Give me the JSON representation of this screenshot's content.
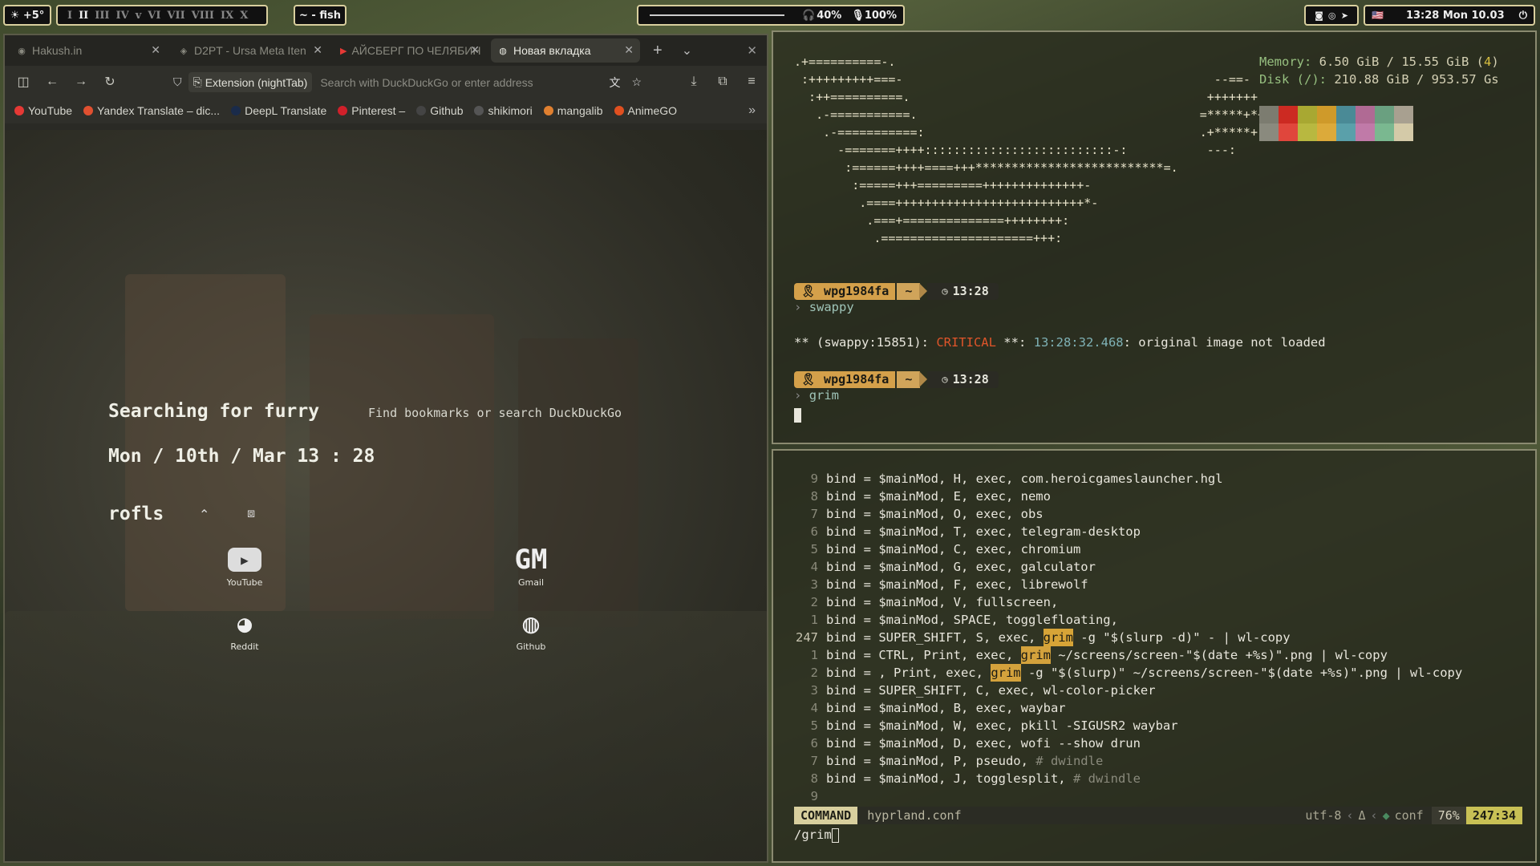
{
  "topbar": {
    "weather": "☀ +5°",
    "workspaces": [
      "I",
      "II",
      "III",
      "IV",
      "v",
      "VI",
      "VII",
      "VIII",
      "IX",
      "X"
    ],
    "active_workspace_index": 1,
    "active_window": "~ - fish",
    "volume": "40%",
    "mic": "100%",
    "clock": "13:28 Mon 10.03",
    "tray_icons": [
      "discord-icon",
      "steam-icon",
      "telegram-icon"
    ],
    "flag": "🇺🇸",
    "power_icon": "⏻"
  },
  "browser": {
    "tabs": [
      {
        "label": "Hakush.in",
        "icon": "◉",
        "active": false
      },
      {
        "label": "D2PT - Ursa Meta Iten",
        "icon": "◈",
        "active": false
      },
      {
        "label": "АЙСБЕРГ ПО ЧЕЛЯБИН",
        "icon": "▶",
        "active": false
      },
      {
        "label": "Новая вкладка",
        "icon": "◍",
        "active": true
      }
    ],
    "new_tab": "+",
    "tab_list": "⌄",
    "close": "✕",
    "extension_badge": "Extension (nightTab)",
    "url_placeholder": "Search with DuckDuckGo or enter address",
    "bookmarks": [
      {
        "label": "YouTube",
        "color": "#e53935"
      },
      {
        "label": "Yandex Translate – dic...",
        "color": "#e05030"
      },
      {
        "label": "DeepL Translate",
        "color": "#1a2b4a"
      },
      {
        "label": "Pinterest –",
        "color": "#d0202a"
      },
      {
        "label": "Github",
        "color": "#444"
      },
      {
        "label": "shikimori",
        "color": "#555"
      },
      {
        "label": "mangalib",
        "color": "#e08030"
      },
      {
        "label": "AnimeGO",
        "color": "#e05020"
      }
    ],
    "bookmarks_overflow": "»",
    "nighttab": {
      "search_title": "Searching for furry",
      "search_hint": "Find bookmarks or search DuckDuckGo",
      "date": "Mon / 10th / Mar  13 : 28",
      "group_name": "rofls",
      "tiles": [
        {
          "label": "YouTube",
          "glyph": "▶"
        },
        {
          "label": "Gmail",
          "glyph": "GM"
        },
        {
          "label": "Reddit",
          "glyph": "◕"
        },
        {
          "label": "Github",
          "glyph": "◍"
        }
      ],
      "bottom_controls": [
        "+",
        "✎",
        "⚙"
      ]
    }
  },
  "term1": {
    "sysinfo": {
      "memory_key": "Memory:",
      "memory_val": "6.50 GiB / 15.55 GiB (",
      "memory_pct": "4",
      "memory_tail": ")",
      "disk_key": "Disk (/):",
      "disk_val": "210.88 GiB / 953.57 Gs"
    },
    "swatches_top": [
      "#7c7c70",
      "#cc2a22",
      "#a8a832",
      "#cf9a2a",
      "#4a8a96",
      "#b06a94",
      "#6aa080",
      "#a8a090"
    ],
    "swatches_bottom": [
      "#8a8a7e",
      "#e0463c",
      "#b8b840",
      "#dcaa3a",
      "#5aa0aa",
      "#c07aa8",
      "#7ab890",
      "#d4caa8"
    ],
    "prompt_user": "wpg1984fa",
    "prompt_dir": "~",
    "prompt_time": "13:28",
    "cmd1": "swappy",
    "err_prefix": "** (swappy:15851): ",
    "err_level": "CRITICAL",
    "err_mid": " **: ",
    "err_time": "13:28:32.468",
    "err_msg": ": original image not loaded",
    "cmd2": "grim"
  },
  "term2": {
    "lines": [
      {
        "n": "9",
        "t": "bind = $mainMod, H, exec, com.heroicgameslauncher.hgl"
      },
      {
        "n": "8",
        "t": "bind = $mainMod, E, exec, nemo"
      },
      {
        "n": "7",
        "t": "bind = $mainMod, O, exec, obs"
      },
      {
        "n": "6",
        "t": "bind = $mainMod, T, exec, telegram-desktop"
      },
      {
        "n": "5",
        "t": "bind = $mainMod, C, exec, chromium"
      },
      {
        "n": "4",
        "t": "bind = $mainMod, G, exec, galculator"
      },
      {
        "n": "3",
        "t": "bind = $mainMod, F, exec, librewolf"
      },
      {
        "n": "2",
        "t": "bind = $mainMod, V, fullscreen,"
      },
      {
        "n": "1",
        "t": "bind = $mainMod, SPACE, togglefloating,"
      }
    ],
    "hl_lines": [
      {
        "n": "247",
        "pre": "bind = SUPER_SHIFT, S, exec, ",
        "hl": "grim",
        "post": " -g \"$(slurp -d)\" - | wl-copy",
        "cur": true
      },
      {
        "n": "1",
        "pre": "bind = CTRL, Print, exec, ",
        "hl": "grim",
        "post": " ~/screens/screen-\"$(date +%s)\".png | wl-copy",
        "cur": false
      },
      {
        "n": "2",
        "pre": "bind = , Print, exec, ",
        "hl": "grim",
        "post": " -g \"$(slurp)\" ~/screens/screen-\"$(date +%s)\".png | wl-copy",
        "cur": false
      }
    ],
    "lines2": [
      {
        "n": "3",
        "t": "bind = SUPER_SHIFT, C, exec, wl-color-picker",
        "c": ""
      },
      {
        "n": "4",
        "t": "bind = $mainMod, B, exec, waybar",
        "c": ""
      },
      {
        "n": "5",
        "t": "bind = $mainMod, W, exec, pkill -SIGUSR2 waybar",
        "c": ""
      },
      {
        "n": "6",
        "t": "bind = $mainMod, D, exec, wofi --show drun",
        "c": ""
      },
      {
        "n": "7",
        "t": "bind = $mainMod, P, pseudo, ",
        "c": "# dwindle"
      },
      {
        "n": "8",
        "t": "bind = $mainMod, J, togglesplit, ",
        "c": "# dwindle"
      },
      {
        "n": "9",
        "t": "",
        "c": ""
      }
    ],
    "status_mode": "COMMAND",
    "status_file": "hyprland.conf",
    "status_enc": "utf-8",
    "status_delta": "Δ",
    "status_ft": "conf",
    "status_pct": "76%",
    "status_pos": "247:34",
    "cmdline": "/grim"
  }
}
